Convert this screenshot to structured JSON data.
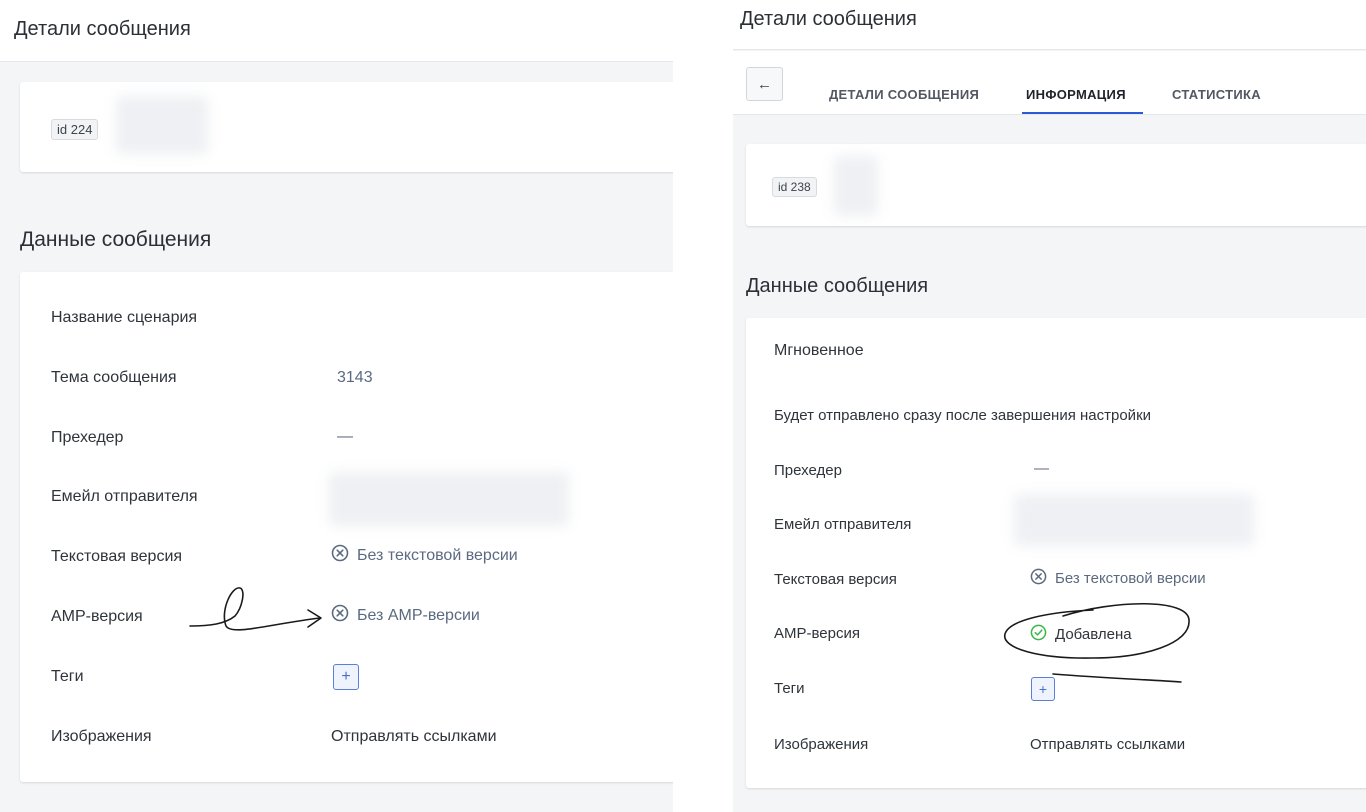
{
  "left": {
    "page_title": "Детали сообщения",
    "id_badge": "id 224",
    "section_title": "Данные сообщения",
    "fields": {
      "scenario_label": "Название сценария",
      "subject_label": "Тема сообщения",
      "subject_value": "3143",
      "preheader_label": "Прехедер",
      "preheader_value": "—",
      "sender_label": "Емейл отправителя",
      "text_label": "Текстовая версия",
      "text_value": "Без текстовой версии",
      "amp_label": "АМР-версия",
      "amp_value": "Без АМР-версии",
      "tags_label": "Теги",
      "tags_add": "+",
      "images_label": "Изображения",
      "images_value": "Отправлять ссылками"
    }
  },
  "right": {
    "page_title": "Детали сообщения",
    "back_icon": "←",
    "tabs": [
      "ДЕТАЛИ СООБЩЕНИЯ",
      "ИНФОРМАЦИЯ",
      "СТАТИСТИКА"
    ],
    "active_tab": "ИНФОРМАЦИЯ",
    "id_badge": "id 238",
    "section_title": "Данные сообщения",
    "send_type": "Мгновенное",
    "send_note": "Будет отправлено сразу после завершения настройки",
    "fields": {
      "preheader_label": "Прехедер",
      "preheader_value": "—",
      "sender_label": "Емейл отправителя",
      "text_label": "Текстовая версия",
      "text_value": "Без текстовой версии",
      "amp_label": "АМР-версия",
      "amp_value": "Добавлена",
      "tags_label": "Теги",
      "tags_add": "+",
      "images_label": "Изображения",
      "images_value": "Отправлять ссылками"
    }
  },
  "colors": {
    "accent": "#2a5bd7",
    "success": "#3bb54a",
    "muted": "#5b6a80"
  },
  "icons": {
    "no_version": "x-circle-icon",
    "added": "check-circle-icon",
    "back": "arrow-left-icon"
  }
}
